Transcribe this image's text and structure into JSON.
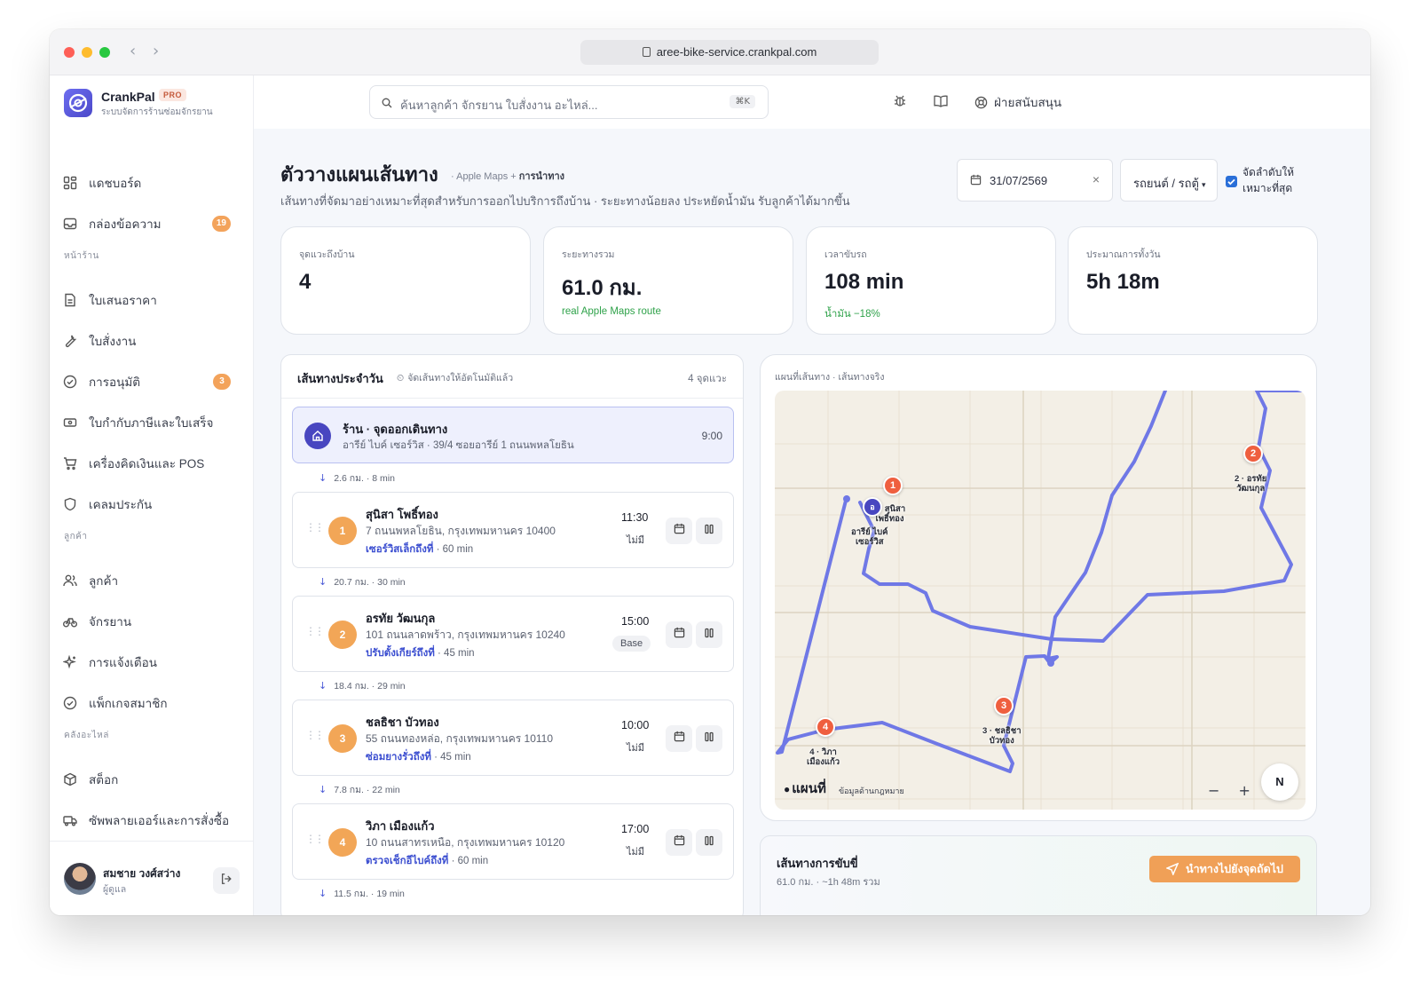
{
  "browser": {
    "url": "aree-bike-service.crankpal.com"
  },
  "brand": {
    "name": "CrankPal",
    "badge": "PRO",
    "subtitle": "ระบบจัดการร้านซ่อมจักรยาน"
  },
  "search": {
    "placeholder": "ค้นหาลูกค้า จักรยาน ใบสั่งงาน อะไหล่...",
    "shortcut": "⌘K"
  },
  "topbar": {
    "support_label": "ฝ่ายสนับสนุน"
  },
  "sidebar": {
    "items": [
      {
        "label": "แดชบอร์ด",
        "icon": "dashboard-icon"
      },
      {
        "label": "กล่องข้อความ",
        "icon": "inbox-icon",
        "badge": "19"
      },
      {
        "label": "ใบเสนอราคา",
        "icon": "quote-icon"
      },
      {
        "label": "ใบสั่งงาน",
        "icon": "wrench-icon"
      },
      {
        "label": "การอนุมัติ",
        "icon": "check-circle-icon",
        "badge": "3"
      },
      {
        "label": "ใบกำกับภาษีและใบเสร็จ",
        "icon": "receipt-icon"
      },
      {
        "label": "เครื่องคิดเงินและ POS",
        "icon": "cart-icon"
      },
      {
        "label": "เคลมประกัน",
        "icon": "shield-icon"
      },
      {
        "label": "ลูกค้า",
        "icon": "users-icon"
      },
      {
        "label": "จักรยาน",
        "icon": "bike-icon"
      },
      {
        "label": "การแจ้งเตือน",
        "icon": "sparkle-icon"
      },
      {
        "label": "แพ็กเกจสมาชิก",
        "icon": "check-circle-icon"
      },
      {
        "label": "สต็อก",
        "icon": "box-icon"
      },
      {
        "label": "ซัพพลายเออร์และการสั่งซื้อ",
        "icon": "truck-icon"
      }
    ],
    "sections": {
      "shop": "หน้าร้าน",
      "customers": "ลูกค้า",
      "parts": "คลังอะไหล่"
    },
    "user": {
      "name": "สมชาย วงศ์สว่าง",
      "role": "ผู้ดูแล"
    }
  },
  "page": {
    "title": "ตัววางแผนเส้นทาง",
    "title_sub": "· Apple Maps + ",
    "title_sub_bold": "การนำทาง",
    "description": "เส้นทางที่จัดมาอย่างเหมาะที่สุดสำหรับการออกไปบริการถึงบ้าน · ระยะทางน้อยลง ประหยัดน้ำมัน รับลูกค้าได้มากขึ้น",
    "date": "31/07/2569",
    "clear": "×",
    "vehicle": "รถยนต์ / รถตู้",
    "optimize_label": "จัดลำดับให้เหมาะที่สุด",
    "optimize_checked": true
  },
  "stats": [
    {
      "label": "จุดแวะถึงบ้าน",
      "value": "4",
      "note": ""
    },
    {
      "label": "ระยะทางรวม",
      "value": "61.0 กม.",
      "note": "real Apple Maps route"
    },
    {
      "label": "เวลาขับรถ",
      "value": "108 min",
      "note": "น้ำมัน −18%"
    },
    {
      "label": "ประมาณการทั้งวัน",
      "value": "5h 18m",
      "note": ""
    }
  ],
  "route": {
    "title": "เส้นทางประจำวัน",
    "subtitle": "จัดเส้นทางให้อัตโนมัติแล้ว",
    "count": "4 จุดแวะ",
    "base": {
      "name": "ร้าน · จุดออกเดินทาง",
      "address": "อารีย์ ไบค์ เซอร์วิส · 39/4 ซอยอารีย์ 1 ถนนพหลโยธิน",
      "time": "9:00"
    },
    "legs": [
      "2.6 กม. · 8 min",
      "20.7 กม. · 30 min",
      "18.4 กม. · 29 min",
      "7.8 กม. · 22 min",
      "11.5 กม. · 19 min"
    ],
    "stops": [
      {
        "num": "1",
        "name": "สุนิสา โพธิ์ทอง",
        "address": "7 ถนนพหลโยธิน, กรุงเทพมหานคร 10400",
        "service": "เซอร์วิสเล็กถึงที่",
        "duration": "· 60 min",
        "time": "11:30",
        "status": "ไม่มี"
      },
      {
        "num": "2",
        "name": "อรทัย วัฒนกุล",
        "address": "101 ถนนลาดพร้าว, กรุงเทพมหานคร 10240",
        "service": "ปรับตั้งเกียร์ถึงที่",
        "duration": "· 45 min",
        "time": "15:00",
        "status": "Base"
      },
      {
        "num": "3",
        "name": "ชลธิชา บัวทอง",
        "address": "55 ถนนทองหล่อ, กรุงเทพมหานคร 10110",
        "service": "ซ่อมยางรั่วถึงที่",
        "duration": "· 45 min",
        "time": "10:00",
        "status": "ไม่มี"
      },
      {
        "num": "4",
        "name": "วิภา เมืองแก้ว",
        "address": "10 ถนนสาทรเหนือ, กรุงเทพมหานคร 10120",
        "service": "ตรวจเช็กอีไบค์ถึงที่",
        "duration": "· 60 min",
        "time": "17:00",
        "status": "ไม่มี"
      }
    ]
  },
  "map": {
    "title": "แผนที่เส้นทาง · เส้นทางจริง",
    "pins": [
      {
        "num": "1",
        "label": "1 · สุนิสา\nโพธิ์ทอง"
      },
      {
        "num": "2",
        "label": "2 · อรทัย\nวัฒนกุล"
      },
      {
        "num": "3",
        "label": "3 · ชลธิชา\nบัวทอง"
      },
      {
        "num": "4",
        "label": "4 · วิภา\nเมืองแก้ว"
      }
    ],
    "base_pin": {
      "num": "อ",
      "label": "อารีย์ ไบค์\nเซอร์วิส"
    },
    "brand": "แผนที่",
    "legal": "ข้อมูลด้านกฎหมาย",
    "zoom": "− +",
    "compass": "N",
    "route_color": "#6f78e6"
  },
  "drive": {
    "title": "เส้นทางการขับขี่",
    "subtitle": "61.0 กม. · ~1h 48m รวม",
    "button": "นำทางไปยังจุดถัดไป"
  }
}
